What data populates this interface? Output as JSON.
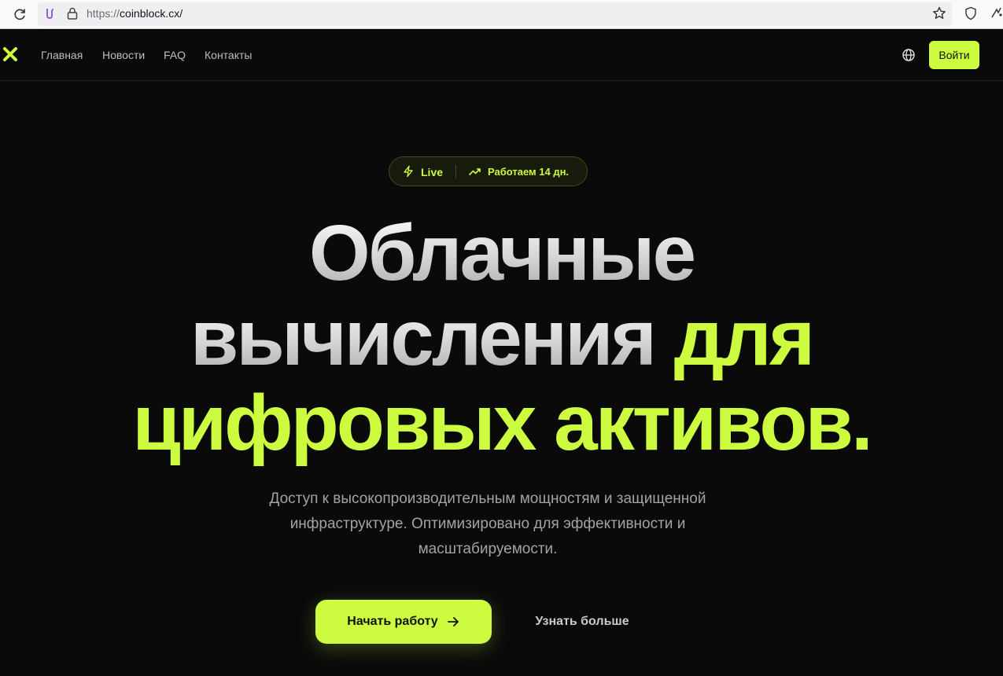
{
  "browser": {
    "url_protocol": "https://",
    "url_host": "coinblock.cx/"
  },
  "nav": {
    "links": [
      "Главная",
      "Новости",
      "FAQ",
      "Контакты"
    ],
    "login_label": "Войти"
  },
  "badge": {
    "live_label": "Live",
    "uptime_label": "Работаем 14 дн."
  },
  "hero": {
    "title_line1": "Облачные",
    "title_line2_plain": "вычисления",
    "title_line2_accent": "для",
    "title_line3": "цифровых активов.",
    "subtitle": "Доступ к высокопроизводительным мощностям и защищенной инфраструктуре. Оптимизировано для эффективности и масштабируемости.",
    "cta_primary": "Начать работу",
    "cta_secondary": "Узнать больше"
  },
  "colors": {
    "accent": "#ccfb3f",
    "background": "#0a0a0a"
  },
  "icons": [
    "reload-icon",
    "site-identity-icon",
    "lock-icon",
    "bookmark-star-icon",
    "tracking-shield-icon",
    "extensions-icon",
    "logo-x-icon",
    "globe-icon",
    "lightning-bolt-icon",
    "trending-up-icon",
    "arrow-right-icon"
  ]
}
